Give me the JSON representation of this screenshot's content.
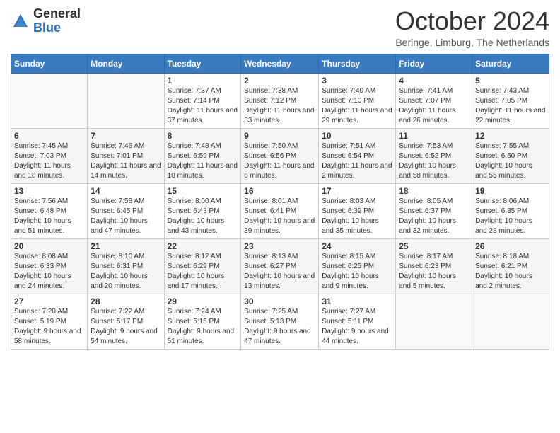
{
  "header": {
    "logo_general": "General",
    "logo_blue": "Blue",
    "month_title": "October 2024",
    "location": "Beringe, Limburg, The Netherlands"
  },
  "days_of_week": [
    "Sunday",
    "Monday",
    "Tuesday",
    "Wednesday",
    "Thursday",
    "Friday",
    "Saturday"
  ],
  "weeks": [
    [
      {
        "day": "",
        "sunrise": "",
        "sunset": "",
        "daylight": ""
      },
      {
        "day": "",
        "sunrise": "",
        "sunset": "",
        "daylight": ""
      },
      {
        "day": "1",
        "sunrise": "Sunrise: 7:37 AM",
        "sunset": "Sunset: 7:14 PM",
        "daylight": "Daylight: 11 hours and 37 minutes."
      },
      {
        "day": "2",
        "sunrise": "Sunrise: 7:38 AM",
        "sunset": "Sunset: 7:12 PM",
        "daylight": "Daylight: 11 hours and 33 minutes."
      },
      {
        "day": "3",
        "sunrise": "Sunrise: 7:40 AM",
        "sunset": "Sunset: 7:10 PM",
        "daylight": "Daylight: 11 hours and 29 minutes."
      },
      {
        "day": "4",
        "sunrise": "Sunrise: 7:41 AM",
        "sunset": "Sunset: 7:07 PM",
        "daylight": "Daylight: 11 hours and 26 minutes."
      },
      {
        "day": "5",
        "sunrise": "Sunrise: 7:43 AM",
        "sunset": "Sunset: 7:05 PM",
        "daylight": "Daylight: 11 hours and 22 minutes."
      }
    ],
    [
      {
        "day": "6",
        "sunrise": "Sunrise: 7:45 AM",
        "sunset": "Sunset: 7:03 PM",
        "daylight": "Daylight: 11 hours and 18 minutes."
      },
      {
        "day": "7",
        "sunrise": "Sunrise: 7:46 AM",
        "sunset": "Sunset: 7:01 PM",
        "daylight": "Daylight: 11 hours and 14 minutes."
      },
      {
        "day": "8",
        "sunrise": "Sunrise: 7:48 AM",
        "sunset": "Sunset: 6:59 PM",
        "daylight": "Daylight: 11 hours and 10 minutes."
      },
      {
        "day": "9",
        "sunrise": "Sunrise: 7:50 AM",
        "sunset": "Sunset: 6:56 PM",
        "daylight": "Daylight: 11 hours and 6 minutes."
      },
      {
        "day": "10",
        "sunrise": "Sunrise: 7:51 AM",
        "sunset": "Sunset: 6:54 PM",
        "daylight": "Daylight: 11 hours and 2 minutes."
      },
      {
        "day": "11",
        "sunrise": "Sunrise: 7:53 AM",
        "sunset": "Sunset: 6:52 PM",
        "daylight": "Daylight: 10 hours and 58 minutes."
      },
      {
        "day": "12",
        "sunrise": "Sunrise: 7:55 AM",
        "sunset": "Sunset: 6:50 PM",
        "daylight": "Daylight: 10 hours and 55 minutes."
      }
    ],
    [
      {
        "day": "13",
        "sunrise": "Sunrise: 7:56 AM",
        "sunset": "Sunset: 6:48 PM",
        "daylight": "Daylight: 10 hours and 51 minutes."
      },
      {
        "day": "14",
        "sunrise": "Sunrise: 7:58 AM",
        "sunset": "Sunset: 6:45 PM",
        "daylight": "Daylight: 10 hours and 47 minutes."
      },
      {
        "day": "15",
        "sunrise": "Sunrise: 8:00 AM",
        "sunset": "Sunset: 6:43 PM",
        "daylight": "Daylight: 10 hours and 43 minutes."
      },
      {
        "day": "16",
        "sunrise": "Sunrise: 8:01 AM",
        "sunset": "Sunset: 6:41 PM",
        "daylight": "Daylight: 10 hours and 39 minutes."
      },
      {
        "day": "17",
        "sunrise": "Sunrise: 8:03 AM",
        "sunset": "Sunset: 6:39 PM",
        "daylight": "Daylight: 10 hours and 35 minutes."
      },
      {
        "day": "18",
        "sunrise": "Sunrise: 8:05 AM",
        "sunset": "Sunset: 6:37 PM",
        "daylight": "Daylight: 10 hours and 32 minutes."
      },
      {
        "day": "19",
        "sunrise": "Sunrise: 8:06 AM",
        "sunset": "Sunset: 6:35 PM",
        "daylight": "Daylight: 10 hours and 28 minutes."
      }
    ],
    [
      {
        "day": "20",
        "sunrise": "Sunrise: 8:08 AM",
        "sunset": "Sunset: 6:33 PM",
        "daylight": "Daylight: 10 hours and 24 minutes."
      },
      {
        "day": "21",
        "sunrise": "Sunrise: 8:10 AM",
        "sunset": "Sunset: 6:31 PM",
        "daylight": "Daylight: 10 hours and 20 minutes."
      },
      {
        "day": "22",
        "sunrise": "Sunrise: 8:12 AM",
        "sunset": "Sunset: 6:29 PM",
        "daylight": "Daylight: 10 hours and 17 minutes."
      },
      {
        "day": "23",
        "sunrise": "Sunrise: 8:13 AM",
        "sunset": "Sunset: 6:27 PM",
        "daylight": "Daylight: 10 hours and 13 minutes."
      },
      {
        "day": "24",
        "sunrise": "Sunrise: 8:15 AM",
        "sunset": "Sunset: 6:25 PM",
        "daylight": "Daylight: 10 hours and 9 minutes."
      },
      {
        "day": "25",
        "sunrise": "Sunrise: 8:17 AM",
        "sunset": "Sunset: 6:23 PM",
        "daylight": "Daylight: 10 hours and 5 minutes."
      },
      {
        "day": "26",
        "sunrise": "Sunrise: 8:18 AM",
        "sunset": "Sunset: 6:21 PM",
        "daylight": "Daylight: 10 hours and 2 minutes."
      }
    ],
    [
      {
        "day": "27",
        "sunrise": "Sunrise: 7:20 AM",
        "sunset": "Sunset: 5:19 PM",
        "daylight": "Daylight: 9 hours and 58 minutes."
      },
      {
        "day": "28",
        "sunrise": "Sunrise: 7:22 AM",
        "sunset": "Sunset: 5:17 PM",
        "daylight": "Daylight: 9 hours and 54 minutes."
      },
      {
        "day": "29",
        "sunrise": "Sunrise: 7:24 AM",
        "sunset": "Sunset: 5:15 PM",
        "daylight": "Daylight: 9 hours and 51 minutes."
      },
      {
        "day": "30",
        "sunrise": "Sunrise: 7:25 AM",
        "sunset": "Sunset: 5:13 PM",
        "daylight": "Daylight: 9 hours and 47 minutes."
      },
      {
        "day": "31",
        "sunrise": "Sunrise: 7:27 AM",
        "sunset": "Sunset: 5:11 PM",
        "daylight": "Daylight: 9 hours and 44 minutes."
      },
      {
        "day": "",
        "sunrise": "",
        "sunset": "",
        "daylight": ""
      },
      {
        "day": "",
        "sunrise": "",
        "sunset": "",
        "daylight": ""
      }
    ]
  ]
}
